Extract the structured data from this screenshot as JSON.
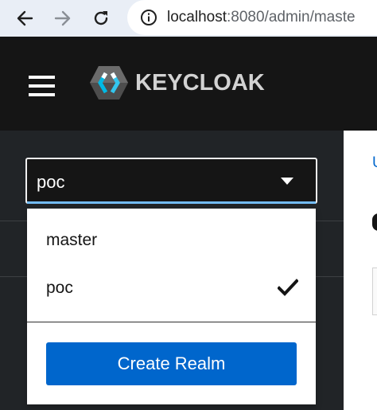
{
  "browser": {
    "url_host": "localhost",
    "url_rest": ":8080/admin/maste"
  },
  "masthead": {
    "brand_name": "KEYCLOAK"
  },
  "realm_selector": {
    "selected": "poc",
    "options": [
      {
        "label": "master",
        "selected": false
      },
      {
        "label": "poc",
        "selected": true
      }
    ],
    "create_label": "Create Realm"
  },
  "main": {
    "link_fragment": "U"
  },
  "colors": {
    "masthead_bg": "#151515",
    "sidebar_bg": "#212427",
    "primary": "#0066cc",
    "focus_underline": "#73bcf7"
  },
  "icons": [
    "back-arrow-icon",
    "forward-arrow-icon",
    "reload-icon",
    "site-info-icon",
    "hamburger-icon",
    "keycloak-logo-icon",
    "caret-down-icon",
    "checkmark-icon"
  ]
}
